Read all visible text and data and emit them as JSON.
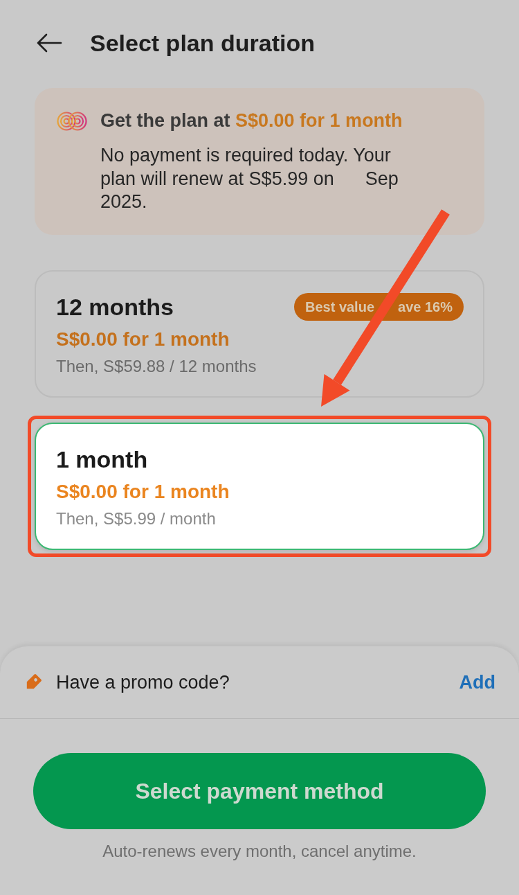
{
  "header": {
    "title": "Select plan duration"
  },
  "offer_banner": {
    "heading": "Get the plan at **S$0.00 for 1 month**",
    "body": "No payment is required today. Your plan will renew at S$5.99 on      Sep 2025."
  },
  "plans": [
    {
      "title": "12 months",
      "offer": "S$0.00 for 1 month",
      "then": "Then, S$59.88 / 12 months",
      "badge": [
        "Best value",
        "ave 16%"
      ],
      "selected": false,
      "annotated": false
    },
    {
      "title": "1 month",
      "offer": "S$0.00 for 1 month",
      "then": "Then, S$5.99 / month",
      "selected": true,
      "annotated": true
    }
  ],
  "promo": {
    "label": "Have a promo code?",
    "action": "Add"
  },
  "primary_button": {
    "label": "Select payment method"
  },
  "footnote": "Auto-renews every month, cancel anytime."
}
